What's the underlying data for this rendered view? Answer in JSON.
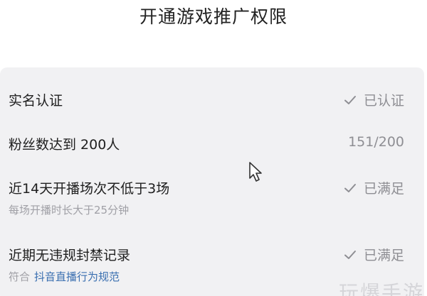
{
  "page": {
    "title": "开通游戏推广权限"
  },
  "requirements": [
    {
      "label": "实名认证",
      "status": "已认证",
      "icon": "check-icon",
      "met": true
    },
    {
      "label": "粉丝数达到 200人",
      "status": "151/200",
      "met": false
    },
    {
      "label": "近14天开播场次不低于3场",
      "status": "已满足",
      "icon": "check-icon",
      "met": true,
      "sub": "每场开播时长大于25分钟"
    },
    {
      "label": "近期无违规封禁记录",
      "status": "已满足",
      "icon": "check-icon",
      "met": true,
      "sub_prefix": "符合",
      "sub_link": "抖音直播行为规范"
    }
  ],
  "watermark": "玩爆手游",
  "colors": {
    "card_bg": "#f1f1f3",
    "status_gray": "#8e8e93",
    "link_blue": "#3a6fb0"
  }
}
